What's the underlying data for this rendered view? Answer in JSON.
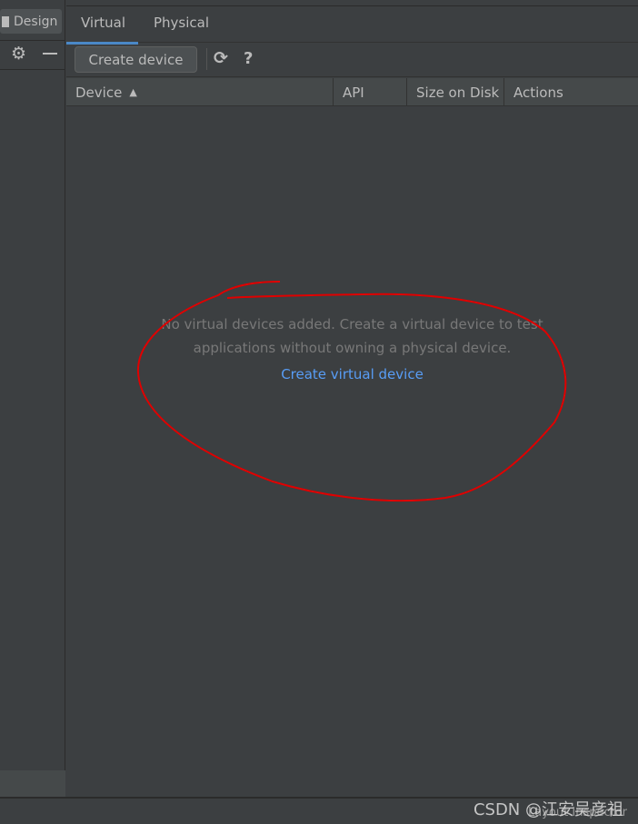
{
  "left_panel": {
    "design_label": "Design"
  },
  "tabs": [
    {
      "label": "Virtual",
      "selected": true
    },
    {
      "label": "Physical",
      "selected": false
    }
  ],
  "toolbar": {
    "create_label": "Create device",
    "refresh_icon": "refresh-icon",
    "help_icon": "?"
  },
  "table": {
    "columns": [
      "Device",
      "API",
      "Size on Disk",
      "Actions"
    ],
    "sort_icon": "▲"
  },
  "empty_state": {
    "line1": "No virtual devices added. Create a virtual device to test",
    "line2": "applications without owning a physical device.",
    "link": "Create virtual device"
  },
  "status_bar": {
    "layout_inspector": "Layout Inspector",
    "watermark": "CSDN @江安吴彦祖"
  },
  "colors": {
    "accent": "#4a88c7",
    "link": "#589df6",
    "annotation": "#e00000"
  }
}
